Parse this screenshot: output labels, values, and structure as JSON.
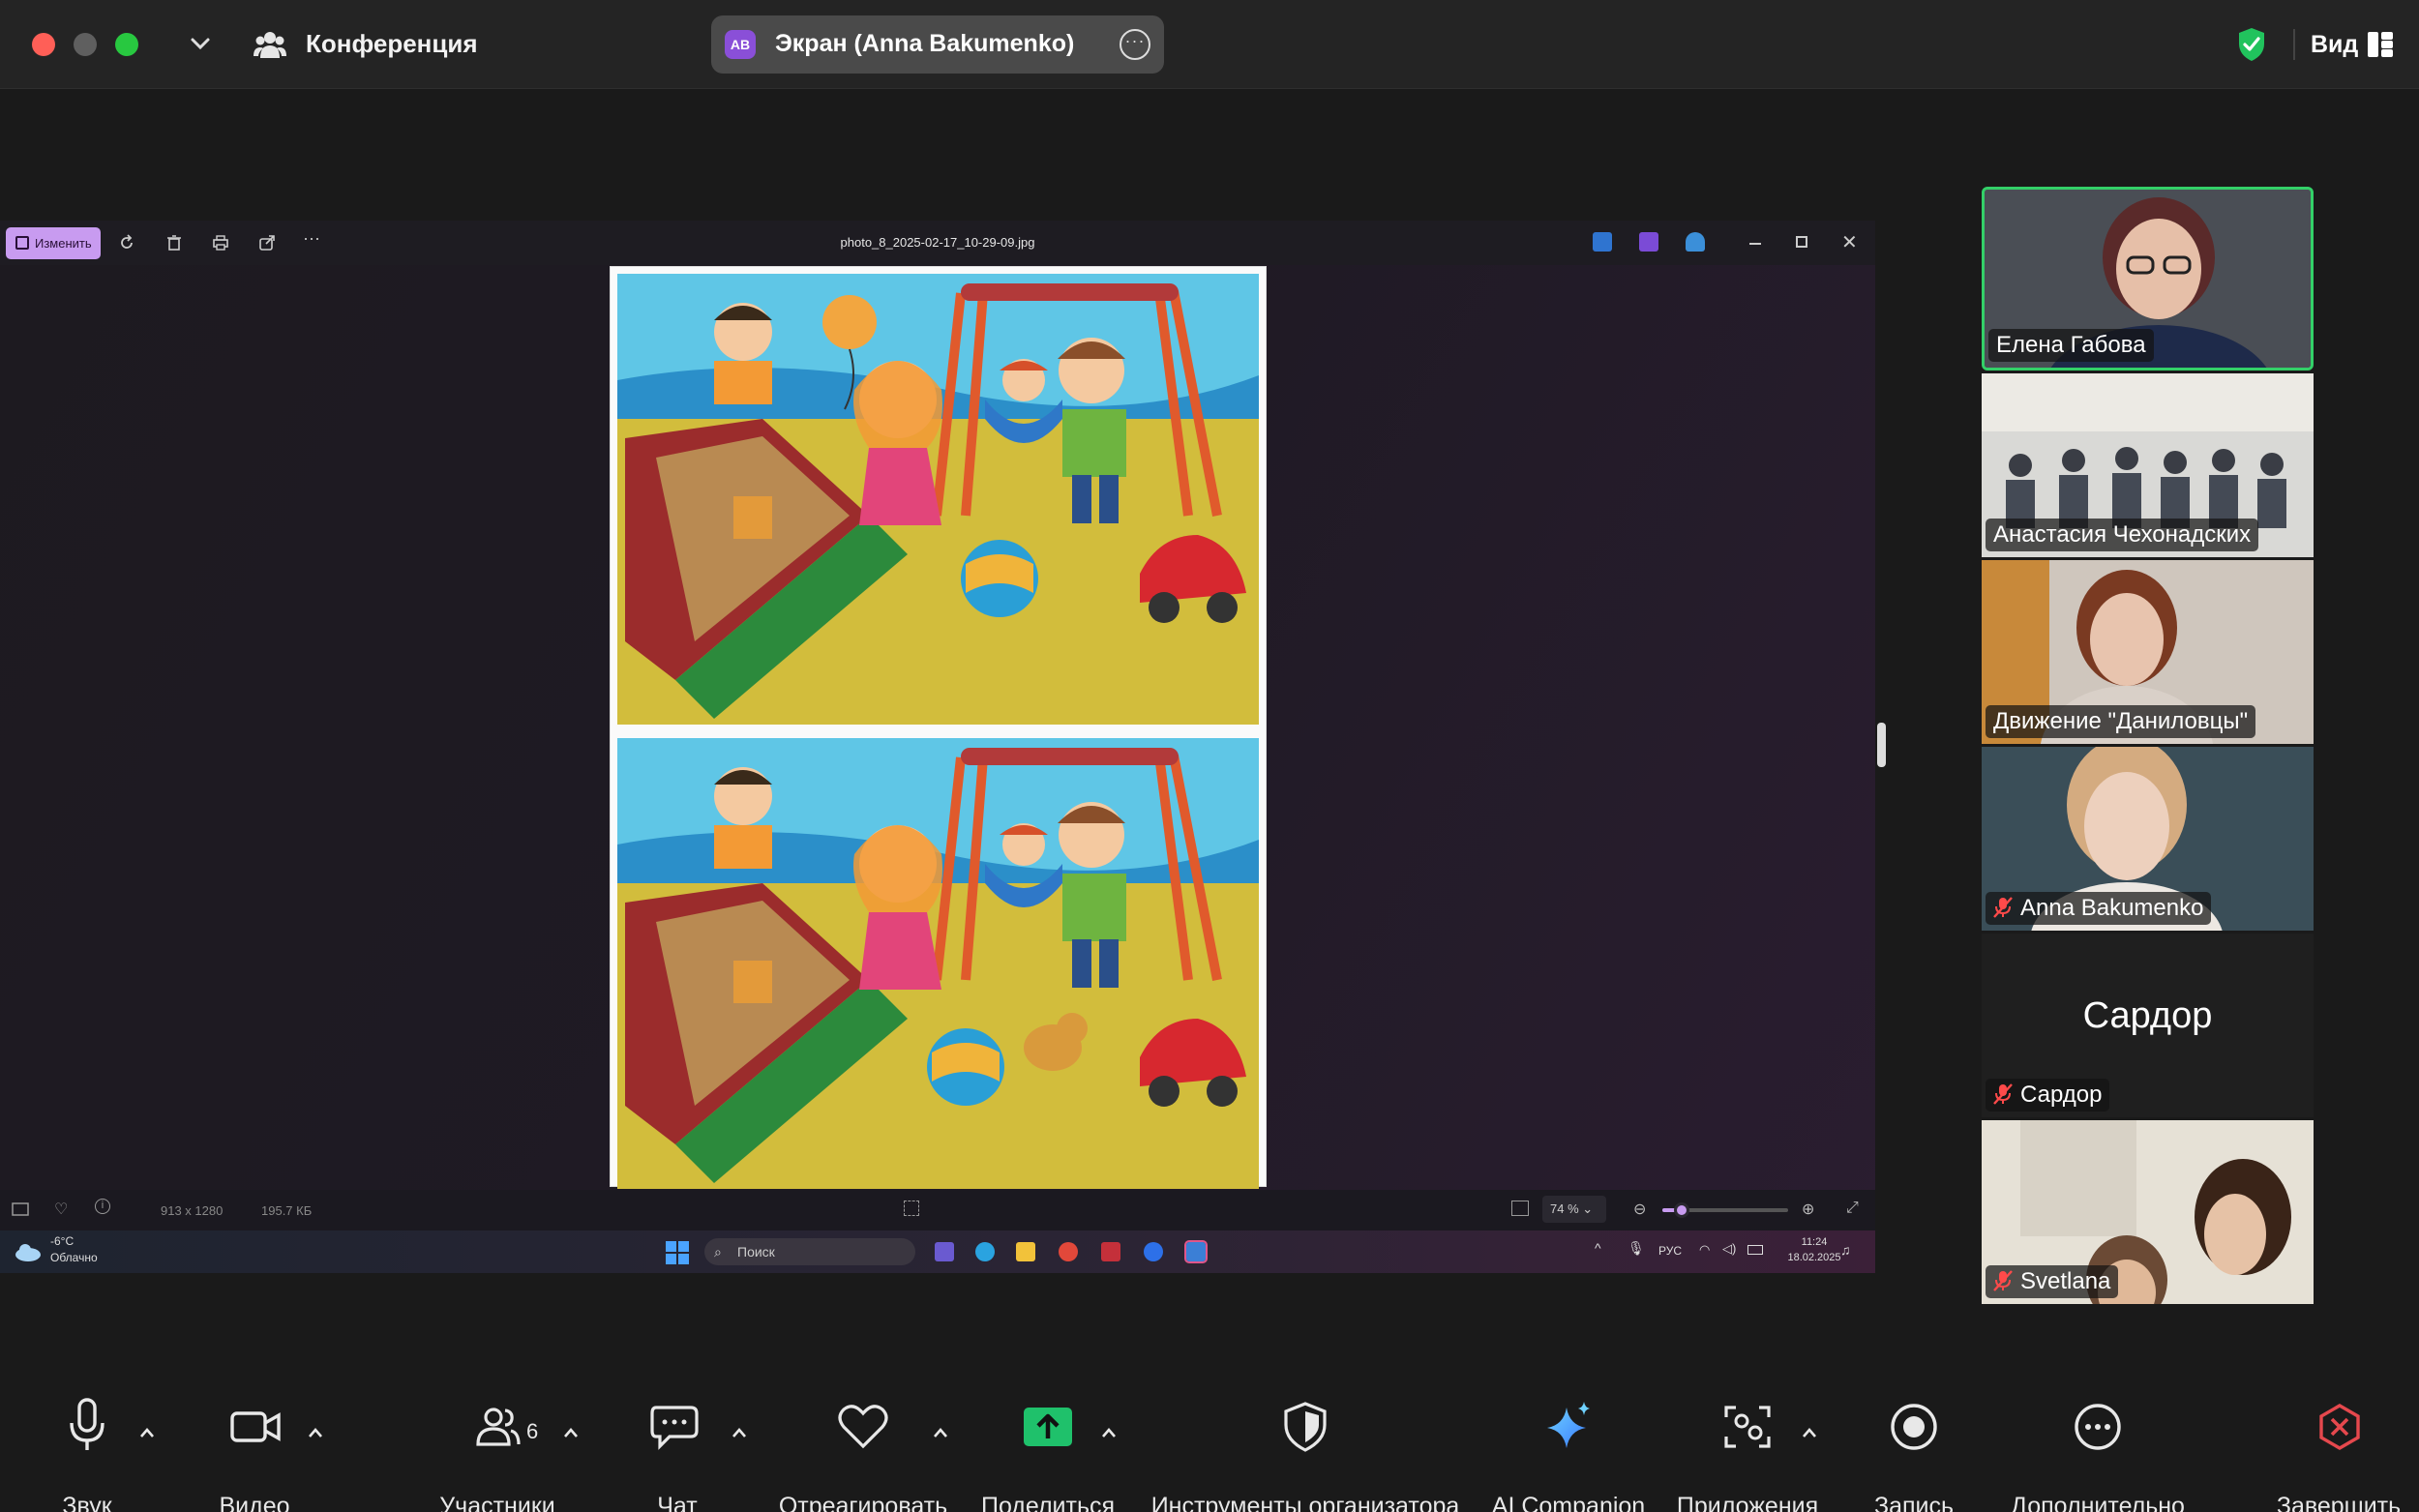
{
  "window": {
    "title": "Конференция"
  },
  "screen_share": {
    "initials": "AB",
    "label": "Экран (Anna Bakumenko)",
    "accent": "#8a4fd8"
  },
  "view_menu": {
    "label": "Вид"
  },
  "security_color": "#21c35d",
  "viewer": {
    "edit_label": "Изменить",
    "filename": "photo_8_2025-02-17_10-29-09.jpg",
    "dimensions": "913 x 1280",
    "filesize": "195.7 КБ",
    "zoom": "74 %"
  },
  "taskbar": {
    "temperature": "-6°C",
    "weather": "Облачно",
    "search_placeholder": "Поиск",
    "language": "РУС",
    "time": "11:24",
    "date": "18.02.2025"
  },
  "participants": [
    {
      "name": "Елена Габова",
      "muted": false,
      "active": true
    },
    {
      "name": "Анастасия Чехонадских",
      "muted": false
    },
    {
      "name": "Движение \"Даниловцы\"",
      "muted": false
    },
    {
      "name": "Anna Bakumenko",
      "muted": true
    },
    {
      "name": "Сардор",
      "muted": true,
      "avatar_text": "Сардор"
    },
    {
      "name": "Svetlana",
      "muted": true
    }
  ],
  "toolbar": {
    "audio": "Звук",
    "video": "Видео",
    "participants": "Участники",
    "participants_count": "6",
    "chat": "Чат",
    "react": "Отреагировать",
    "share": "Поделиться",
    "host_tools": "Инструменты организатора",
    "ai_companion": "AI Companion",
    "apps": "Приложения",
    "record": "Запись",
    "more": "Дополнительно",
    "end": "Завершить",
    "share_color": "#1fc16b",
    "end_color": "#e5484d"
  }
}
